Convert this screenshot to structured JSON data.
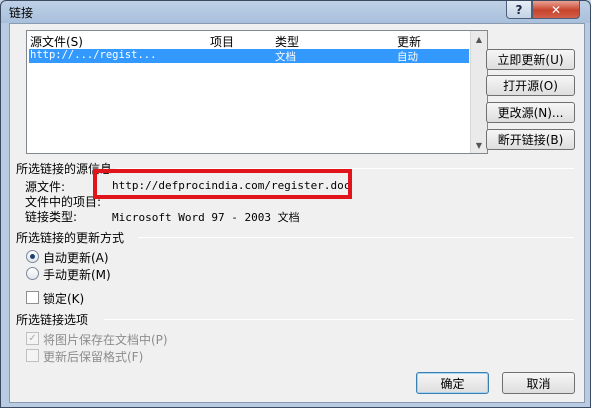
{
  "window": {
    "title": "链接"
  },
  "links_list": {
    "columns": [
      "源文件(S)",
      "项目",
      "类型",
      "更新"
    ],
    "rows": [
      {
        "source": "http://.../regist...",
        "item": "",
        "type": "文档",
        "update": "自动"
      }
    ]
  },
  "side_buttons": {
    "update_now": "立即更新(U)",
    "open_source": "打开源(O)",
    "change_source": "更改源(N)...",
    "break_link": "断开链接(B)"
  },
  "source_info": {
    "heading": "所选链接的源信息",
    "source_file_label": "源文件:",
    "source_file_value": "http://defprocindia.com/register.doc",
    "item_label": "文件中的项目:",
    "link_type_label": "链接类型:",
    "link_type_value": "Microsoft Word 97 - 2003 文档"
  },
  "update_method": {
    "heading": "所选链接的更新方式",
    "auto_label": "自动更新(A)",
    "manual_label": "手动更新(M)",
    "locked_label": "锁定(K)",
    "selected": "auto"
  },
  "link_options": {
    "heading": "所选链接选项",
    "save_picture_label": "将图片保存在文档中(P)",
    "save_picture_checked": true,
    "preserve_format_label": "更新后保留格式(F)",
    "preserve_format_checked": false
  },
  "dialog_buttons": {
    "ok": "确定",
    "cancel": "取消"
  },
  "colors": {
    "selection": "#3399ff",
    "highlight_box": "#e1141b",
    "title_bar": "#bdd0e6"
  }
}
